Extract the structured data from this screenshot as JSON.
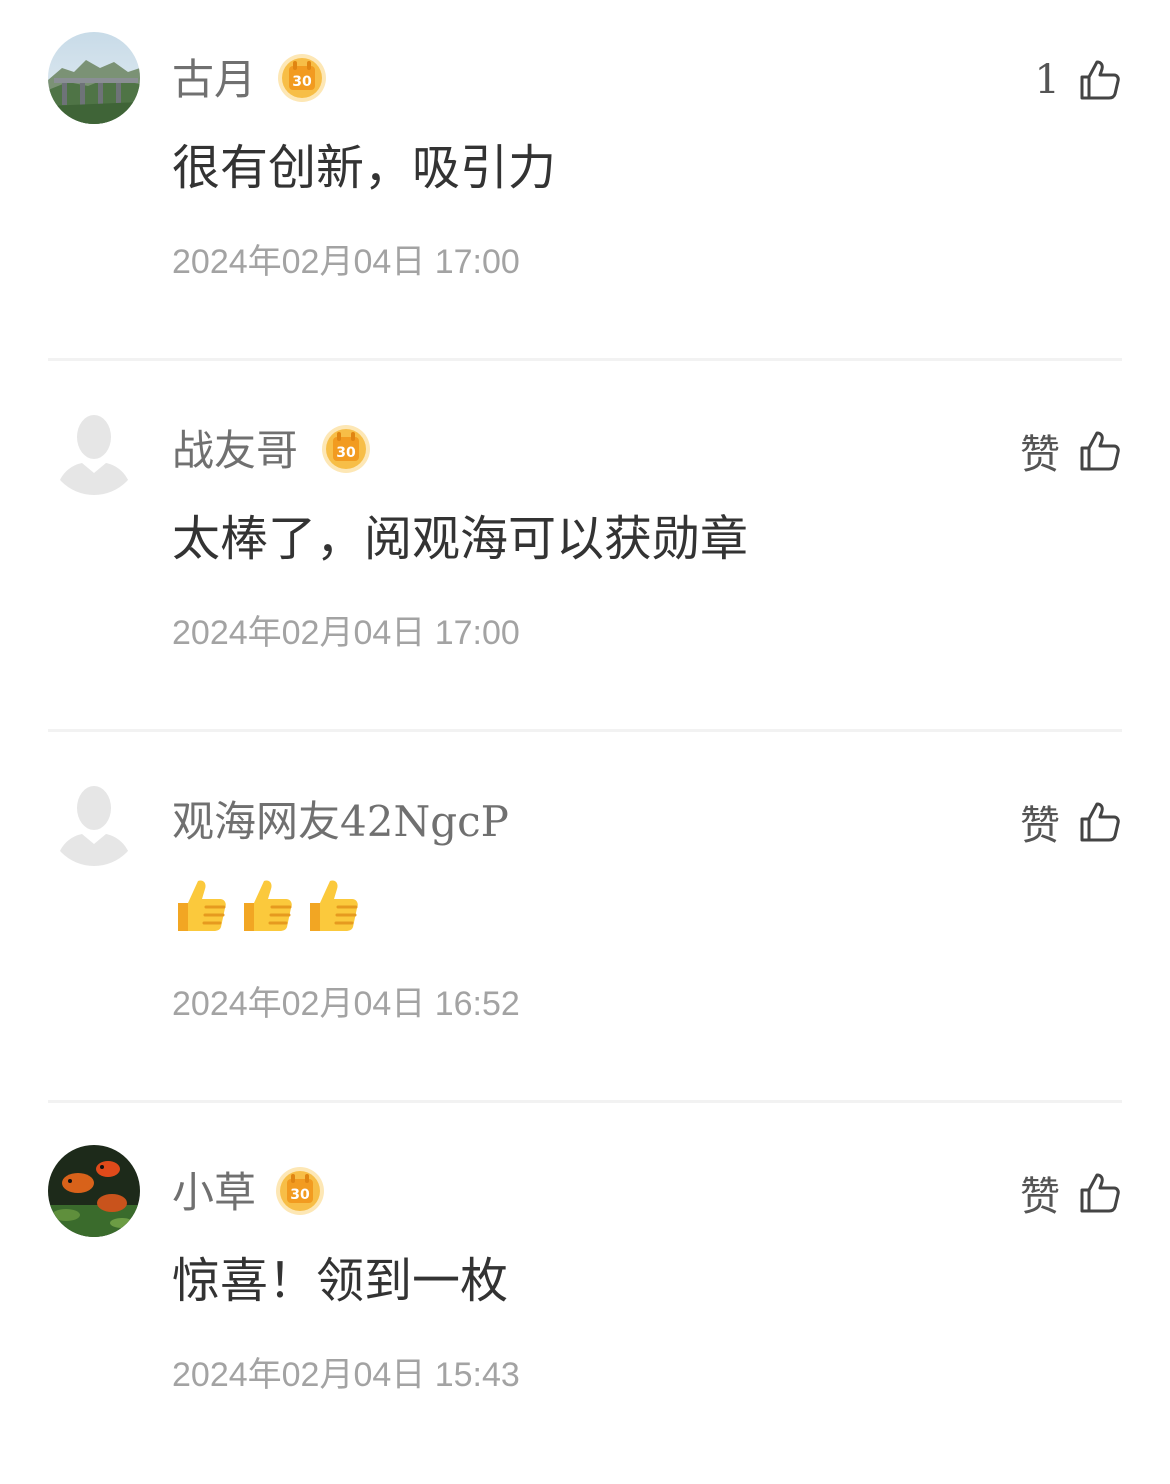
{
  "comments": [
    {
      "username": "古月",
      "badge": "30",
      "content": "很有创新，吸引力",
      "timestamp": "2024年02月04日 17:00",
      "like_label": "1"
    },
    {
      "username": "战友哥",
      "badge": "30",
      "content": "太棒了，阅观海可以获勋章",
      "timestamp": "2024年02月04日 17:00",
      "like_label": "赞"
    },
    {
      "username": "观海网友42NgcP",
      "content": "👍👍👍",
      "timestamp": "2024年02月04日 16:52",
      "like_label": "赞"
    },
    {
      "username": "小草",
      "badge": "30",
      "content": "惊喜！领到一枚",
      "timestamp": "2024年02月04日 15:43",
      "like_label": "赞"
    }
  ],
  "icons": {
    "badge": "calendar-30-medal-icon",
    "like": "thumbs-up-outline-icon",
    "default_avatar": "default-user-silhouette-icon"
  },
  "colors": {
    "username": "#707070",
    "content": "#333333",
    "timestamp": "#a3a3a3",
    "badge_gold": "#f5b73b",
    "divider": "#f2f2f2"
  }
}
